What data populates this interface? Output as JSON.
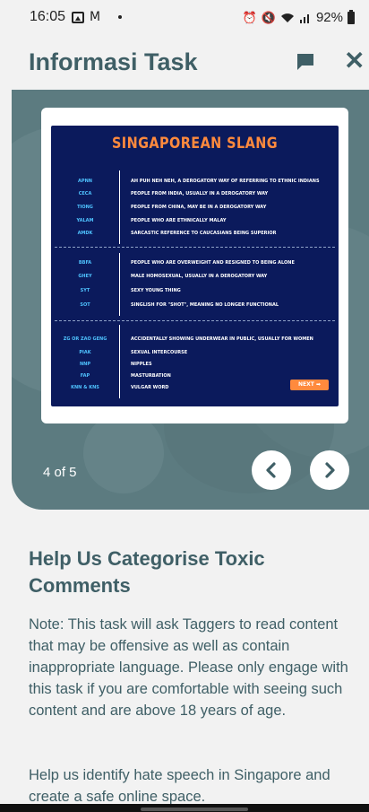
{
  "status_bar": {
    "time": "16:05",
    "mail_icon": "M",
    "battery": "92%"
  },
  "app_bar": {
    "title": "Informasi Task"
  },
  "carousel": {
    "counter": "4 of 5",
    "slide": {
      "title": "SINGAPOREAN SLANG",
      "groups": [
        [
          {
            "term": "APNN",
            "definition": "AH PUH NEH NEH, A DEROGATORY WAY OF REFERRING TO ETHNIC INDIANS"
          },
          {
            "term": "CECA",
            "definition": "PEOPLE FROM INDIA, USUALLY IN A DEROGATORY WAY"
          },
          {
            "term": "TIONG",
            "definition": "PEOPLE FROM CHINA, MAY BE IN A DEROGATORY WAY"
          },
          {
            "term": "YALAM",
            "definition": "PEOPLE WHO ARE ETHNICALLY MALAY"
          },
          {
            "term": "AMDK",
            "definition": "SARCASTIC REFERENCE TO CAUCASIANS BEING SUPERIOR"
          }
        ],
        [
          {
            "term": "BBFA",
            "definition": "PEOPLE WHO ARE OVERWEIGHT AND RESIGNED TO BEING ALONE"
          },
          {
            "term": "GHEY",
            "definition": "MALE HOMOSEXUAL, USUALLY IN A DEROGATORY WAY"
          },
          {
            "term": "SYT",
            "definition": "SEXY YOUNG THING"
          },
          {
            "term": "SOT",
            "definition": "SINGLISH FOR \"SHOT\", MEANING NO LONGER FUNCTIONAL"
          }
        ],
        [
          {
            "term": "ZG OR ZAO GENG",
            "definition": "ACCIDENTALLY SHOWING UNDERWEAR IN PUBLIC, USUALLY FOR WOMEN"
          },
          {
            "term": "PIAK",
            "definition": "SEXUAL INTERCOURSE"
          },
          {
            "term": "NNP",
            "definition": "NIPPLES"
          },
          {
            "term": "FAP",
            "definition": "MASTURBATION"
          },
          {
            "term": "KNN & KNS",
            "definition": "VULGAR WORD"
          }
        ]
      ],
      "next_label": "NEXT ➡"
    }
  },
  "content": {
    "title": "Help Us Categorise Toxic Comments",
    "note": "Note: This task will ask Taggers to read content that may be offensive as well as contain inappropriate language. Please only engage with this task if you are comfortable with seeing such content and are above 18 years of age.",
    "description": "Help us identify hate speech in Singapore and create a safe online space."
  },
  "colors": {
    "primary_text": "#3f5f66",
    "hero_background": "#5c7b80",
    "slide_background": "#0b1a5c",
    "slide_accent": "#ff8a3d",
    "slide_term": "#4fc3ff"
  }
}
